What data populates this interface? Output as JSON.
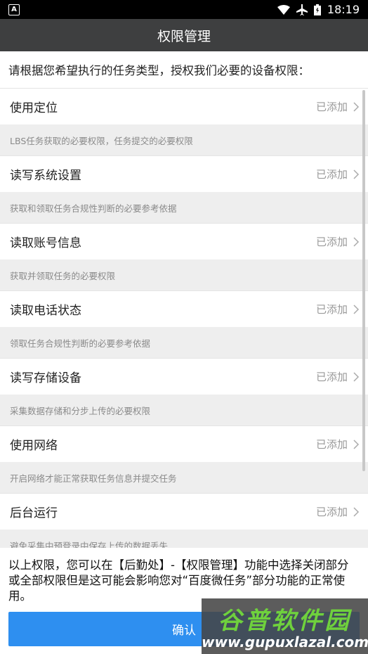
{
  "status_bar": {
    "time": "18:19",
    "icons": [
      "notification-a-icon",
      "wifi-icon",
      "airplane-icon",
      "battery-icon"
    ]
  },
  "app_bar": {
    "title": "权限管理"
  },
  "intro": "请根据您希望执行的任务类型，授权我们必要的设备权限：",
  "permissions": [
    {
      "title": "使用定位",
      "status": "已添加",
      "desc": "LBS任务获取的必要权限，任务提交的必要权限"
    },
    {
      "title": "读写系统设置",
      "status": "已添加",
      "desc": "获取和领取任务合规性判断的必要参考依据"
    },
    {
      "title": "读取账号信息",
      "status": "已添加",
      "desc": "获取并领取任务的必要权限"
    },
    {
      "title": "读取电话状态",
      "status": "已添加",
      "desc": "领取任务合规性判断的必要参考依据"
    },
    {
      "title": "读写存储设备",
      "status": "已添加",
      "desc": "采集数据存储和分步上传的必要权限"
    },
    {
      "title": "使用网络",
      "status": "已添加",
      "desc": "开启网络才能正常获取任务信息并提交任务"
    },
    {
      "title": "后台运行",
      "status": "已添加",
      "desc": "避免采集中预登录中保存上传的数据丢失"
    }
  ],
  "footer_text": "以上权限，您可以在【后勤处】-【权限管理】功能中选择关闭部分或全部权限但是这可能会影响您对“百度微任务”部分功能的正常使用。",
  "confirm_label": "确认",
  "watermark": {
    "title": "谷普软件园",
    "url": "www.gupuxlazal.com"
  },
  "colors": {
    "app_bar": "#3e3f40",
    "confirm": "#2e8ff0",
    "desc_bg": "#eeeeee"
  }
}
